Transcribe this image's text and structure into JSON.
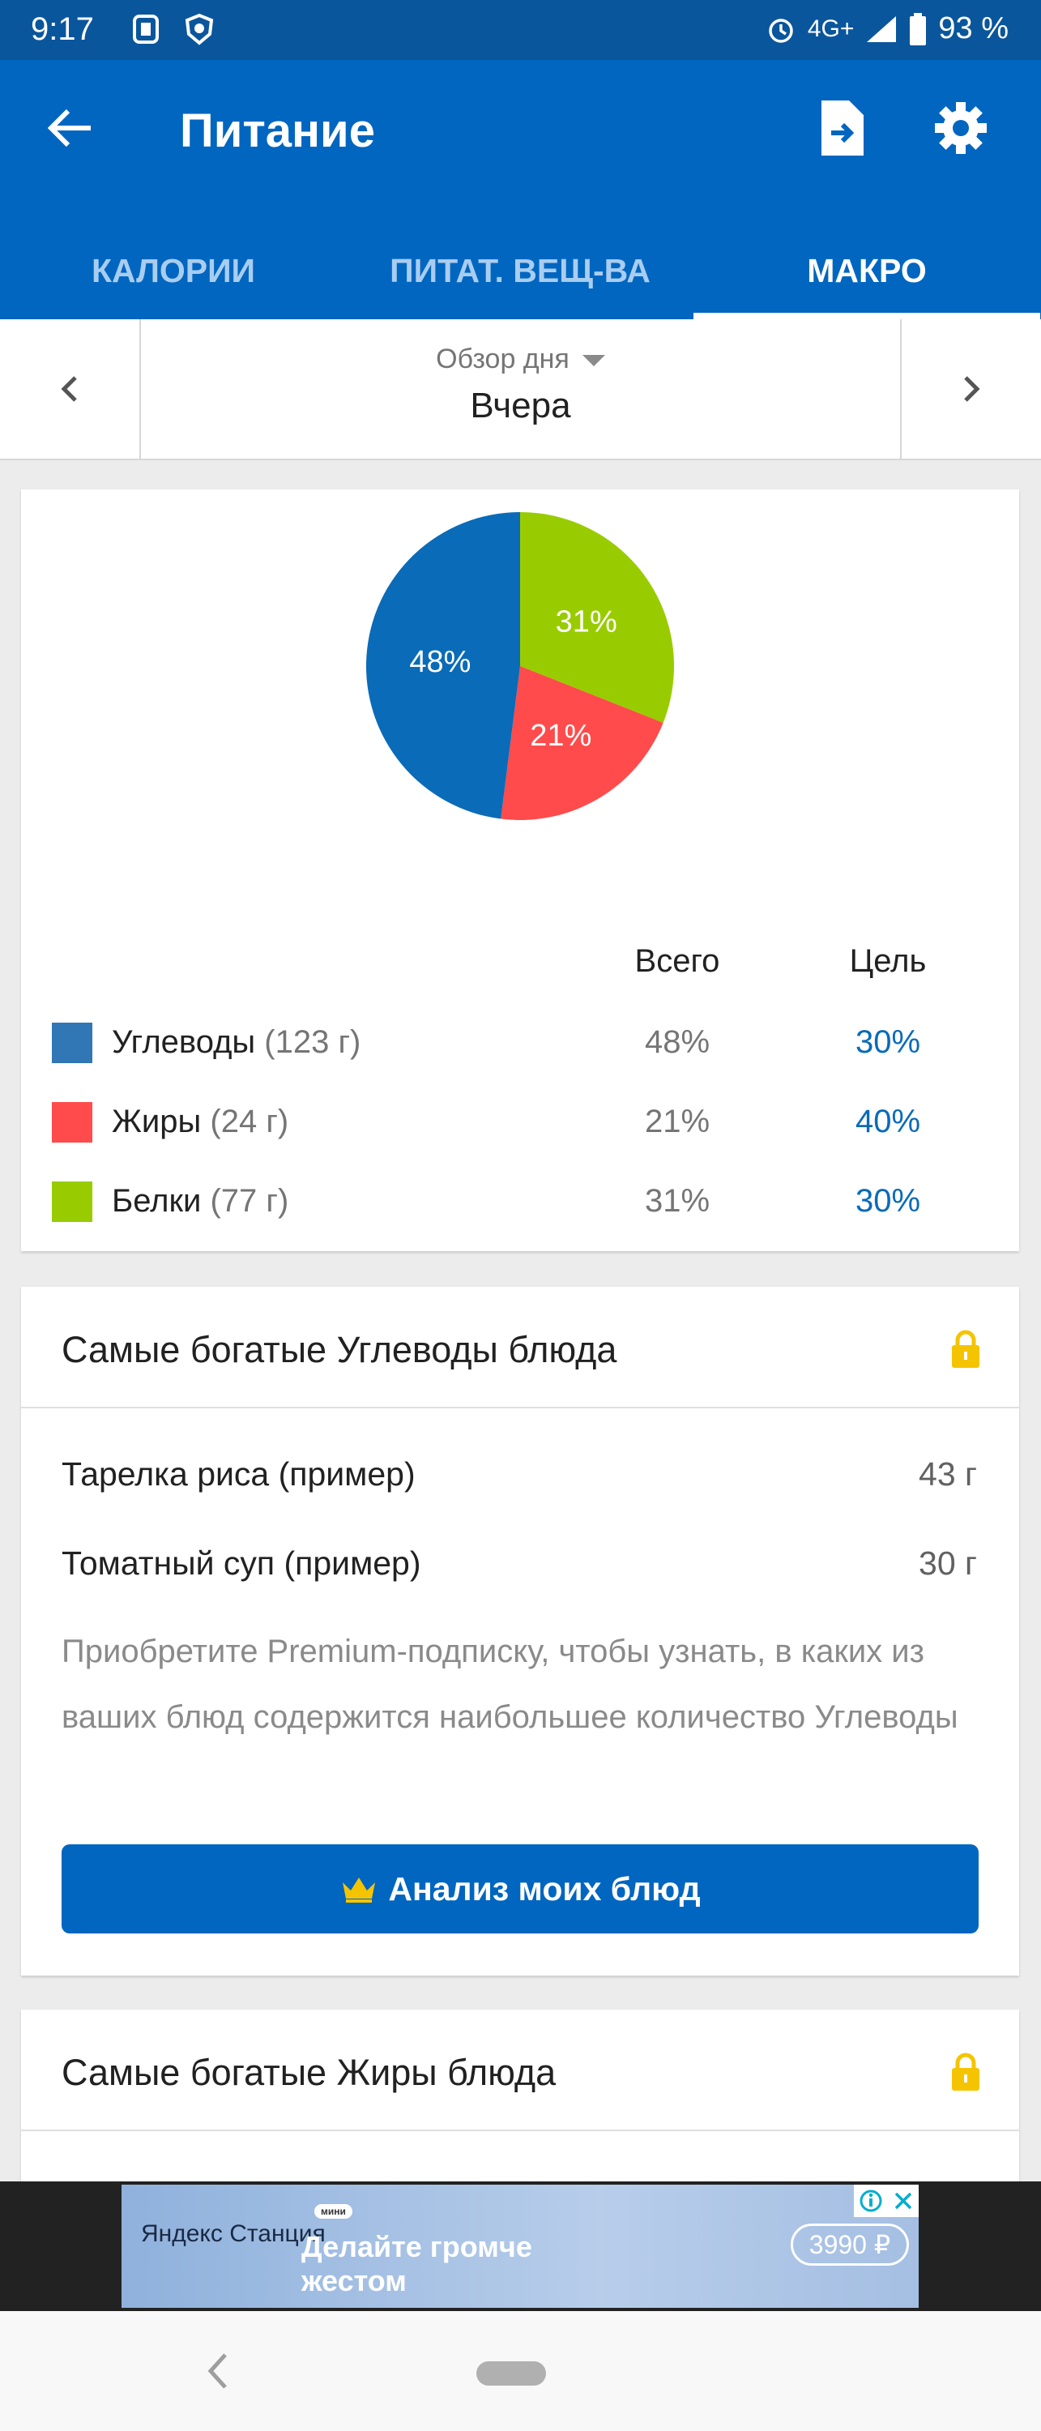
{
  "status_bar": {
    "time": "9:17",
    "network": "4G+",
    "battery": "93 %"
  },
  "app_bar": {
    "title": "Питание",
    "tabs": [
      {
        "label": "КАЛОРИИ",
        "active": false
      },
      {
        "label": "ПИТАТ. ВЕЩ-ВА",
        "active": false
      },
      {
        "label": "МАКРО",
        "active": true
      }
    ]
  },
  "day_selector": {
    "mode": "Обзор дня",
    "day": "Вчера"
  },
  "macros": {
    "col_total": "Всего",
    "col_goal": "Цель",
    "rows": [
      {
        "name": "Углеводы",
        "grams": "(123 г)",
        "total": "48%",
        "goal": "30%",
        "color": "#3177b5"
      },
      {
        "name": "Жиры",
        "grams": "(24 г)",
        "total": "21%",
        "goal": "40%",
        "color": "#ff4b4b"
      },
      {
        "name": "Белки",
        "grams": "(77 г)",
        "total": "31%",
        "goal": "30%",
        "color": "#99cc00"
      }
    ]
  },
  "chart_data": {
    "type": "pie",
    "categories": [
      "Углеводы",
      "Жиры",
      "Белки"
    ],
    "values": [
      48,
      21,
      31
    ],
    "labels": [
      "48%",
      "21%",
      "31%"
    ],
    "colors": [
      "#0a6bb8",
      "#ff4b4b",
      "#99cc00"
    ]
  },
  "carbs_card": {
    "title": "Самые богатые Углеводы блюда",
    "foods": [
      {
        "name": "Тарелка риса (пример)",
        "amount": "43 г"
      },
      {
        "name": "Томатный суп (пример)",
        "amount": "30 г"
      }
    ],
    "promo": "Приобретите Premium-подписку, чтобы узнать, в каких из ваших блюд содержится наибольшее количество Углеводы",
    "button": "Анализ моих блюд"
  },
  "fats_card": {
    "title": "Самые богатые Жиры блюда"
  },
  "ad": {
    "brand": "Яндекс Станция",
    "badge": "мини",
    "headline_line1": "Делайте громче",
    "headline_line2": "жестом",
    "price": "3990 ₽"
  }
}
